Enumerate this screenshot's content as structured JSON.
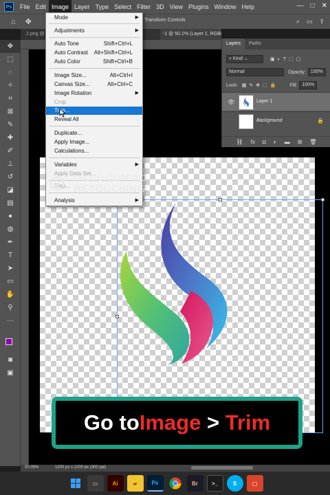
{
  "app": {
    "logo": "Ps"
  },
  "menubar": {
    "items": [
      "File",
      "Edit",
      "Image",
      "Layer",
      "Type",
      "Select",
      "Filter",
      "3D",
      "View",
      "Plugins",
      "Window",
      "Help"
    ],
    "active": "Image"
  },
  "window_controls": {
    "minimize": "—",
    "maximize": "□",
    "close": "✕"
  },
  "options_bar": {
    "transform_controls": "Transform Controls"
  },
  "document_tabs": {
    "tab1": "2.png @",
    "tab2": "-1 @ 50.1% (Layer 1, RGB/8) *",
    "close": "×"
  },
  "image_menu": {
    "items": [
      {
        "label": "Mode",
        "shortcut": "",
        "submenu": true,
        "disabled": false,
        "highlighted": false
      },
      {
        "label": "Adjustments",
        "shortcut": "",
        "submenu": true,
        "disabled": false,
        "highlighted": false
      },
      {
        "label": "Auto Tone",
        "shortcut": "Shift+Ctrl+L",
        "submenu": false,
        "disabled": false,
        "highlighted": false
      },
      {
        "label": "Auto Contrast",
        "shortcut": "Alt+Shift+Ctrl+L",
        "submenu": false,
        "disabled": false,
        "highlighted": false
      },
      {
        "label": "Auto Color",
        "shortcut": "Shift+Ctrl+B",
        "submenu": false,
        "disabled": false,
        "highlighted": false
      },
      {
        "label": "Image Size...",
        "shortcut": "Alt+Ctrl+I",
        "submenu": false,
        "disabled": false,
        "highlighted": false
      },
      {
        "label": "Canvas Size...",
        "shortcut": "Alt+Ctrl+C",
        "submenu": false,
        "disabled": false,
        "highlighted": false
      },
      {
        "label": "Image Rotation",
        "shortcut": "",
        "submenu": true,
        "disabled": false,
        "highlighted": false
      },
      {
        "label": "Crop",
        "shortcut": "",
        "submenu": false,
        "disabled": true,
        "highlighted": false
      },
      {
        "label": "Trim...",
        "shortcut": "",
        "submenu": false,
        "disabled": false,
        "highlighted": true
      },
      {
        "label": "Reveal All",
        "shortcut": "",
        "submenu": false,
        "disabled": false,
        "highlighted": false
      },
      {
        "label": "Duplicate...",
        "shortcut": "",
        "submenu": false,
        "disabled": false,
        "highlighted": false
      },
      {
        "label": "Apply Image...",
        "shortcut": "",
        "submenu": false,
        "disabled": false,
        "highlighted": false
      },
      {
        "label": "Calculations...",
        "shortcut": "",
        "submenu": false,
        "disabled": false,
        "highlighted": false
      },
      {
        "label": "Variables",
        "shortcut": "",
        "submenu": true,
        "disabled": false,
        "highlighted": false
      },
      {
        "label": "Apply Data Set...",
        "shortcut": "",
        "submenu": false,
        "disabled": true,
        "highlighted": false
      },
      {
        "label": "Trap...",
        "shortcut": "",
        "submenu": false,
        "disabled": true,
        "highlighted": false
      },
      {
        "label": "Analysis",
        "shortcut": "",
        "submenu": true,
        "disabled": false,
        "highlighted": false
      }
    ]
  },
  "watermark": {
    "line1": "PHOTO CLIPPING",
    "line2": "RETOUCHING"
  },
  "layers_panel": {
    "tabs": [
      "Layers",
      "Paths"
    ],
    "filter": "Kind",
    "blend_mode": "Normal",
    "opacity_label": "Opacity:",
    "opacity_value": "100%",
    "lock_label": "Lock:",
    "fill_label": "Fill:",
    "fill_value": "100%",
    "layers": [
      {
        "name": "Layer 1",
        "selected": true,
        "visible": true
      },
      {
        "name": "Background",
        "selected": false,
        "visible": false,
        "locked": true
      }
    ],
    "bottom_icons": [
      "link-icon",
      "fx-icon",
      "mask-icon",
      "adjustment-icon",
      "group-icon",
      "new-layer-icon",
      "delete-icon"
    ]
  },
  "caption": {
    "part1": "Go to ",
    "part2": "Image",
    "part3": " > ",
    "part4": "Trim"
  },
  "status": {
    "zoom": "50.09%",
    "doc_info": "1200 px x 1200 px (300 ppi)"
  },
  "taskbar": {
    "apps": [
      "windows-start",
      "file-explorer",
      "illustrator",
      "folder",
      "photoshop",
      "chrome",
      "bridge",
      "terminal",
      "skype",
      "sticky-app"
    ]
  },
  "colors": {
    "accent_blue": "#1976d2",
    "caption_border": "#1ba38a",
    "caption_red": "#ef2a2a",
    "foreground_swatch": "#8f00ab"
  }
}
